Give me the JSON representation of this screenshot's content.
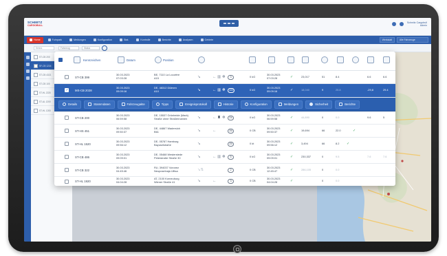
{
  "app": {
    "logo_line1": "SCHMITZ",
    "logo_line2": "CARGOBULL",
    "user_name": "Schmitz Cargobull",
    "user_sub": "Admin"
  },
  "nav": {
    "items": [
      {
        "label": "Home"
      },
      {
        "label": "Fuhrpark"
      },
      {
        "label": "Meldungen"
      },
      {
        "label": "Konfiguration"
      },
      {
        "label": "Stat."
      },
      {
        "label": "Kontrolle"
      },
      {
        "label": "Berichte"
      },
      {
        "label": "Analysen"
      },
      {
        "label": "Gebiete"
      }
    ],
    "right_select_1": "Werkstatt",
    "right_select_2": "Alle Fahrzeuge"
  },
  "filters": {
    "field_1": "Kennz.",
    "field_2": "Fahrzeug",
    "field_3": "Status"
  },
  "background_list": [
    "ST-CB 200",
    "SF-CB 1234",
    "ST-CB 4321",
    "ST-CB 100",
    "ST-HL 2220",
    "ST-AL 1200",
    "ST-HL 1200"
  ],
  "table": {
    "columns": {
      "plate": "Kennzeichen",
      "date": "Datum",
      "position": "Position"
    },
    "rows": [
      {
        "plate": "ST-CB 399",
        "date": "30.03.2023",
        "time": "07:03:28",
        "pos1": "BE, 7110 La Louvière",
        "pos2": "A15",
        "count": "3",
        "v1": "0 kG",
        "d1": "30.03.2023",
        "d2": "07:03:28",
        "n1": "23,017",
        "n2": "51",
        "n3": "8.4",
        "n4": "6.6",
        "n5": "6.6"
      },
      {
        "plate": "MS-CB 2028",
        "date": "30.03.2023",
        "time": "09:09:16",
        "pos1": "DE, 48312 Dülmen",
        "pos2": "A10",
        "count": "100",
        "v1": "0 kG",
        "d1": "30.03.2023",
        "d2": "09:09:16",
        "n1": "18,040",
        "n2": "9",
        "n3": "25.8",
        "n4": "-29,8",
        "n5": "29.4"
      },
      {
        "plate": "ST-CB 200",
        "date": "30.03.2023",
        "time": "06:59:58",
        "pos1": "DE, 15537 Grünheide (Mark)",
        "pos2": "Straße ohne Straßennamen",
        "count": "24",
        "v1": "0 kG",
        "d1": "30.03.2023",
        "d2": "06:59:58",
        "n1": "44,890",
        "n2": "0",
        "n3": "0.0",
        "n4": "9.6",
        "n5": "5"
      },
      {
        "plate": "ST-HS 451",
        "date": "30.03.2023",
        "time": "09:50:37",
        "pos1": "DE, 44867 Wadersloh",
        "pos2": "B61",
        "count": "26",
        "v1": "0 CB",
        "d1": "30.03.2023",
        "d2": "09:50:37",
        "n1": "19,694",
        "n2": "66",
        "n3": "22.0",
        "n4": "",
        "n5": ""
      },
      {
        "plate": "ST-HL 1520",
        "date": "30.03.2023",
        "time": "09:56:12",
        "pos1": "DE, 05787 Hamburg",
        "pos2": "Bayuselstraße",
        "count": "25",
        "v1": "0 kt",
        "d1": "30.03.2023",
        "d2": "09:56:12",
        "n1": "3,494",
        "n2": "66",
        "n3": "8.2",
        "n4": "",
        "n5": ""
      },
      {
        "plate": "ST-CB 486",
        "date": "30.03.2023",
        "time": "09:09:01",
        "pos1": "DE, 05468 Westerstede",
        "pos2": "Peterstraße Straße 30",
        "count": "5",
        "v1": "0 kG",
        "d1": "30.03.2023",
        "d2": "09:09:01",
        "n1": "230,337",
        "n2": "0",
        "n3": "9.5",
        "n4": "7.6",
        "n5": "7.6"
      },
      {
        "plate": "ST-CB 322",
        "date": "30.03.2023",
        "time": "04:45:46",
        "pos1": "RU, 394037 Voronez",
        "pos2": "Neuposelnaja Ulitsa",
        "count": "2",
        "v1": "0 CB",
        "d1": "30.03.2023",
        "d2": "12:45:47",
        "n1": "286,105",
        "n2": "0",
        "n3": "0.0",
        "n4": "",
        "n5": ""
      },
      {
        "plate": "ST-HL 1920",
        "date": "30.03.2023",
        "time": "04:04:28",
        "pos1": "AT, 2100 Korneuburg",
        "pos2": "Wiener Straße 41",
        "count": "3",
        "v1": "0 CB",
        "d1": "30.03.2023",
        "d2": "04:04:28",
        "n1": "",
        "n2": "0",
        "n3": "0.0",
        "n4": "",
        "n5": ""
      }
    ]
  },
  "actions": [
    {
      "label": "Details"
    },
    {
      "label": "Stammdaten"
    },
    {
      "label": "Fahrzeugakte"
    },
    {
      "label": "Tipps"
    },
    {
      "label": "Ereignisprotokoll"
    },
    {
      "label": "Historie"
    },
    {
      "label": "Konfiguration"
    },
    {
      "label": "Meldungen"
    },
    {
      "label": "Sicherheit"
    },
    {
      "label": "Berichte"
    }
  ],
  "colors": {
    "brand_blue": "#2d5eab",
    "selected_row": "#2e63b7",
    "active_nav": "#d9352b",
    "ok_green": "#3aa15a"
  }
}
